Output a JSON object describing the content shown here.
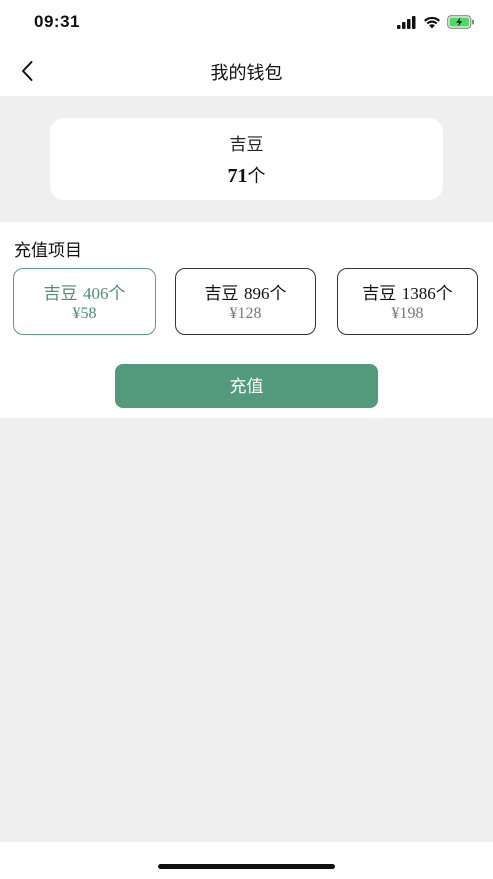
{
  "status_bar": {
    "time": "09:31",
    "icons": [
      "signal-icon",
      "wifi-icon",
      "battery-charging-icon"
    ]
  },
  "nav": {
    "back_icon": "chevron-left-icon",
    "title": "我的钱包"
  },
  "balance": {
    "label": "吉豆",
    "amount": "71",
    "unit": "个"
  },
  "recharge": {
    "title": "充值项目",
    "packages": [
      {
        "name": "吉豆",
        "amount": "406",
        "unit": "个",
        "price": "¥58",
        "selected": true
      },
      {
        "name": "吉豆",
        "amount": "896",
        "unit": "个",
        "price": "¥128",
        "selected": false
      },
      {
        "name": "吉豆",
        "amount": "1386",
        "unit": "个",
        "price": "¥198",
        "selected": false
      }
    ],
    "button_label": "充值"
  },
  "colors": {
    "accent": "#539a7d",
    "background": "#efefef",
    "card": "#ffffff"
  }
}
